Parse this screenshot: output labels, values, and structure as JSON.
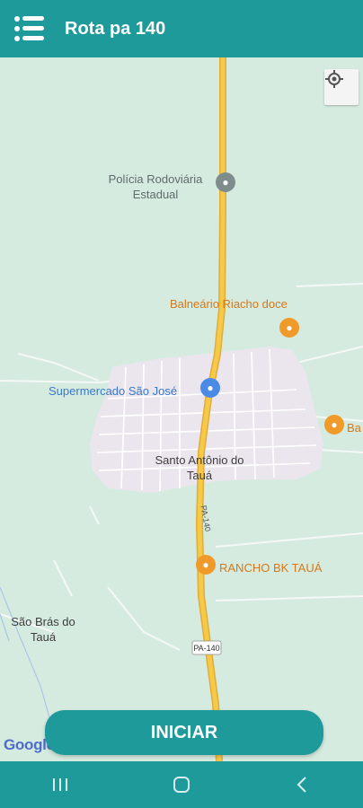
{
  "app": {
    "title": "Rota pa 140",
    "menu_icon": "menu-icon"
  },
  "map": {
    "labels": {
      "policia": "Polícia Rodoviária Estadual",
      "balneario": "Balneário Riacho doce",
      "supermercado": "Supermercado São José",
      "santo_antonio": "Santo Antônio do Tauá",
      "rancho": "RANCHO BK TAUÁ",
      "sao_bras": "São Brás do Tauá",
      "partial_label": "Ba",
      "road_upper": "PA-140",
      "road_lower": "PA-140"
    },
    "locate_icon": "my-location-icon",
    "attribution": "Google"
  },
  "actions": {
    "start_label": "INICIAR"
  },
  "system_nav": {
    "recents_icon": "recents-icon",
    "home_icon": "home-icon",
    "back_icon": "back-icon"
  },
  "colors": {
    "brand": "#1e9a9a",
    "map_background": "#d6ebe0",
    "highway": "#f6c94a",
    "town": "#ebe6ee",
    "poi_food": "#f09a29",
    "poi_shop": "#4a8be6"
  }
}
